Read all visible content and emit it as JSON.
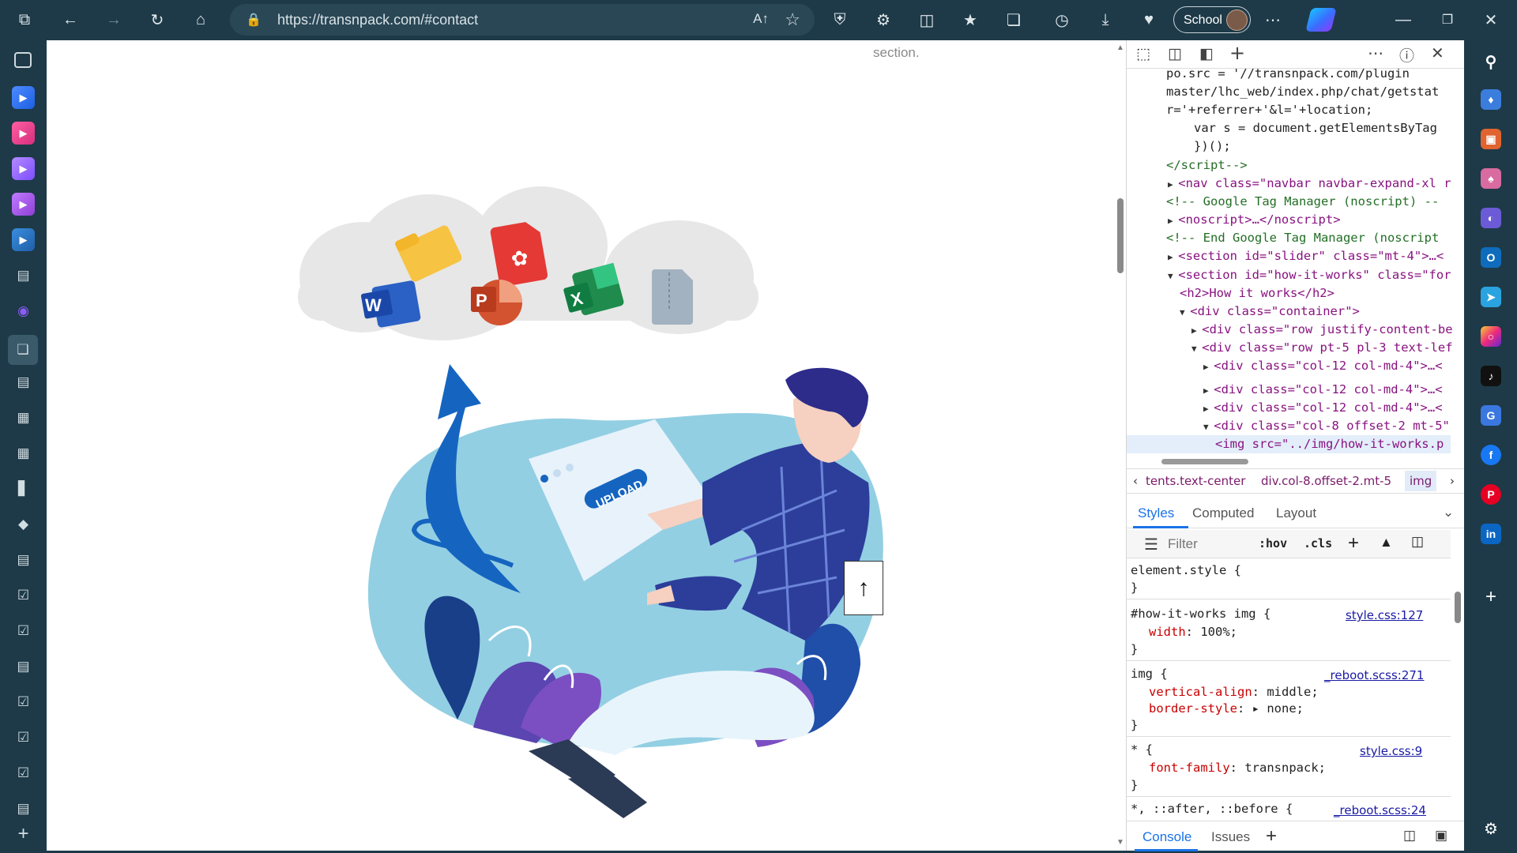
{
  "browser": {
    "url": "https://transnpack.com/#contact",
    "read_aloud": "A↑",
    "profile_label": "School",
    "toolbar_icons": [
      "workspaces-icon",
      "back-icon",
      "forward-icon",
      "refresh-icon",
      "home-icon",
      "shield-icon",
      "extensions-icon",
      "split-screen-icon",
      "favorites-icon",
      "collections-icon",
      "history-icon",
      "downloads-icon",
      "performance-icon",
      "more-icon",
      "copilot-icon"
    ],
    "window_icons": [
      "minimize-icon",
      "restore-icon",
      "close-icon"
    ]
  },
  "page": {
    "section_text": "section.",
    "upload_label": "UPLOAD",
    "back_to_top": "↑"
  },
  "devtools": {
    "elements_lines": [
      "po.src = '//transnpack.com/plugin",
      "master/lhc_web/index.php/chat/getstat",
      "r='+referrer+'&l='+location;",
      "var s = document.getElementsByTag",
      "})();",
      "</script-->",
      "<nav class=\"navbar navbar-expand-xl r",
      "<!-- Google Tag Manager (noscript) --",
      "<noscript>…</noscript>",
      "<!-- End Google Tag Manager (noscript",
      "<section id=\"slider\" class=\"mt-4\">…<",
      "<section id=\"how-it-works\" class=\"for",
      "<h2>How it works</h2>",
      "<div class=\"container\">",
      "<div class=\"row justify-content-be",
      "<div class=\"row pt-5 pl-3 text-lef",
      "<div class=\"col-12 col-md-4\">…<",
      "<div class=\"col-12 col-md-4\">…<",
      "<div class=\"col-12 col-md-4\">…<",
      "<div class=\"col-8 offset-2 mt-5\"",
      "<img src=\"../img/how-it-works.p"
    ],
    "breadcrumbs": [
      "‹",
      "tents.text-center",
      "div.col-8.offset-2.mt-5",
      "img",
      "›"
    ],
    "tabs": [
      "Styles",
      "Computed",
      "Layout"
    ],
    "filter_placeholder": "Filter",
    "filter_tools": [
      ":hov",
      ".cls",
      "+"
    ],
    "rules": [
      {
        "selector": "element.style {",
        "decls": [],
        "file": ""
      },
      {
        "selector": "#how-it-works img {",
        "decls": [
          {
            "prop": "width",
            "val": "100%;"
          }
        ],
        "file": "style.css:127"
      },
      {
        "selector": "img {",
        "decls": [
          {
            "prop": "vertical-align",
            "val": "middle;"
          },
          {
            "prop": "border-style",
            "val": "▸ none;"
          }
        ],
        "file": "_reboot.scss:271"
      },
      {
        "selector": "* {",
        "decls": [
          {
            "prop": "font-family",
            "val": "transnpack;"
          }
        ],
        "file": "style.css:9"
      },
      {
        "selector": "*, ::after, ::before {",
        "decls": [],
        "file": "_reboot.scss:24"
      }
    ],
    "drawer_tabs": [
      "Console",
      "Issues",
      "+"
    ]
  },
  "colors": {
    "chrome_bg": "#1e3a48",
    "accent_blue": "#1565c0",
    "blob": "#93cfe3"
  }
}
